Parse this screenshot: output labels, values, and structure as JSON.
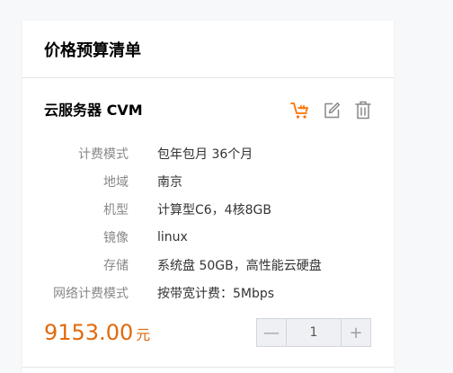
{
  "card": {
    "title": "价格预算清单"
  },
  "product": {
    "name": "云服务器 CVM",
    "actions": [
      {
        "icon": "cart-icon",
        "color": "#ff7200"
      },
      {
        "icon": "edit-icon",
        "color": "#888888"
      },
      {
        "icon": "trash-icon",
        "color": "#888888"
      }
    ],
    "specs": [
      {
        "label": "计费模式",
        "value": "包年包月 36个月"
      },
      {
        "label": "地域",
        "value": "南京"
      },
      {
        "label": "机型",
        "value": "计算型C6，4核8GB"
      },
      {
        "label": "镜像",
        "value": "linux"
      },
      {
        "label": "存储",
        "value": "系统盘 50GB，高性能云硬盘"
      },
      {
        "label": "网络计费模式",
        "value": "按带宽计费：5Mbps"
      }
    ],
    "price": {
      "amount": "9153.00",
      "unit": "元"
    },
    "quantity": {
      "value": "1",
      "minus_label": "—",
      "plus_label": "+"
    }
  },
  "colors": {
    "accent": "#e06a0d",
    "cart": "#ff7200"
  }
}
